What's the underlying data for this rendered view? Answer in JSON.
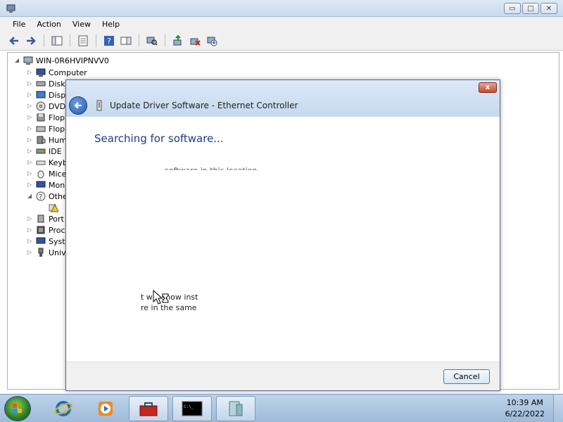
{
  "device_manager": {
    "menu": [
      "File",
      "Action",
      "View",
      "Help"
    ],
    "root": "WIN-0R6HVIPNVV0",
    "tree_items": [
      {
        "label": "Computer",
        "icon": "computer-icon"
      },
      {
        "label": "Disk",
        "icon": "disk-icon"
      },
      {
        "label": "Disp",
        "icon": "display-icon"
      },
      {
        "label": "DVD",
        "icon": "dvd-icon"
      },
      {
        "label": "Flop",
        "icon": "floppy-icon"
      },
      {
        "label": "Flop",
        "icon": "floppy-drive-icon"
      },
      {
        "label": "Hum",
        "icon": "hid-icon"
      },
      {
        "label": "IDE",
        "icon": "ide-icon"
      },
      {
        "label": "Keyb",
        "icon": "keyboard-icon"
      },
      {
        "label": "Mice",
        "icon": "mouse-icon"
      },
      {
        "label": "Mon",
        "icon": "monitor-icon"
      },
      {
        "label": "Othe",
        "icon": "other-devices-icon"
      },
      {
        "label": "",
        "icon": "warning-device-icon"
      },
      {
        "label": "Port",
        "icon": "port-icon"
      },
      {
        "label": "Proc",
        "icon": "processor-icon"
      },
      {
        "label": "Syst",
        "icon": "system-icon"
      },
      {
        "label": "Univ",
        "icon": "usb-icon"
      }
    ]
  },
  "dialog": {
    "title": "Update Driver Software - Ethernet Controller",
    "heading": "Searching for software...",
    "faint_line": "software in this location",
    "partial_line_1": "t will show inst",
    "partial_line_2": "re in the same c",
    "cancel_label": "Cancel",
    "close_label": "x"
  },
  "taskbar": {
    "time": "10:39 AM",
    "date": "6/22/2022"
  },
  "colors": {
    "heading": "#1e3b87",
    "title_bar": "#c9d9ee",
    "taskbar": "#9fbad8"
  }
}
